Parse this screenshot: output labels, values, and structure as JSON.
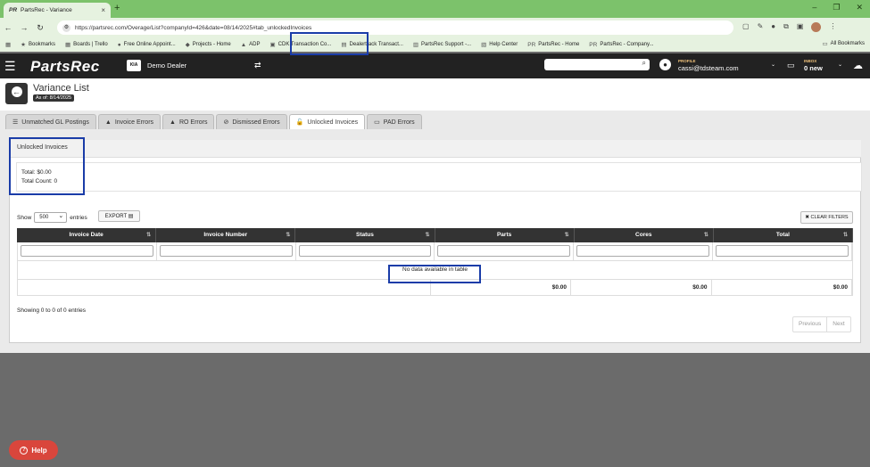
{
  "browser": {
    "tab_title": "PartsRec - Variance",
    "tab_icon": "PR",
    "url": "https://partsrec.com/Overage/List?companyId=426&date=08/14/2025#tab_unlockedInvoices",
    "bookmarks": [
      {
        "icon": "★",
        "label": "Bookmarks"
      },
      {
        "icon": "▦",
        "label": "Boards | Trello"
      },
      {
        "icon": "●",
        "label": "Free Online Appoint..."
      },
      {
        "icon": "◆",
        "label": "Projects - Home"
      },
      {
        "icon": "▲",
        "label": "ADP"
      },
      {
        "icon": "▣",
        "label": "CDK Transaction Co..."
      },
      {
        "icon": "▤",
        "label": "Dealertrack Transact..."
      },
      {
        "icon": "▥",
        "label": "PartsRec Support -..."
      },
      {
        "icon": "▧",
        "label": "Help Center"
      },
      {
        "icon": "PR",
        "label": "PartsRec - Home"
      },
      {
        "icon": "PR",
        "label": "PartsRec - Company..."
      }
    ],
    "all_bookmarks": "All Bookmarks"
  },
  "app": {
    "logo": "PartsRec",
    "dealer_logo_text": "KIA",
    "dealer_name": "Demo Dealer",
    "profile_label": "PROFILE",
    "profile_email": "cassi@tdsteam.com",
    "inbox_label": "INBOX",
    "inbox_count": "0 new"
  },
  "page": {
    "title": "Variance List",
    "as_of": "As of: 8/14/2025"
  },
  "tabs": [
    {
      "icon": "☰",
      "label": "Unmatched GL Postings"
    },
    {
      "icon": "▲",
      "label": "Invoice Errors"
    },
    {
      "icon": "▲",
      "label": "RO Errors"
    },
    {
      "icon": "⊘",
      "label": "Dismissed Errors"
    },
    {
      "icon": "🔓",
      "label": "Unlocked Invoices"
    },
    {
      "icon": "▭",
      "label": "PAD Errors"
    }
  ],
  "panel": {
    "title": "Unlocked Invoices",
    "total": "Total: $0.00",
    "total_count": "Total Count: 0"
  },
  "controls": {
    "show_label": "Show",
    "entries_value": "500",
    "entries_label": "entries",
    "export_label": "EXPORT",
    "clear_filters_label": "CLEAR FILTERS"
  },
  "table": {
    "columns": [
      "Invoice Date",
      "Invoice Number",
      "Status",
      "Parts",
      "Cores",
      "Total"
    ],
    "empty_message": "No data available in table",
    "totals": [
      "$0.00",
      "$0.00",
      "$0.00"
    ]
  },
  "footer": {
    "showing": "Showing 0 to 0 of 0 entries",
    "previous": "Previous",
    "next": "Next"
  },
  "help": {
    "label": "Help"
  },
  "colors": {
    "browser_chrome": "#7cc26b",
    "app_header": "#222222",
    "highlight_box": "#1a3ca8",
    "help_button": "#d9463c"
  }
}
